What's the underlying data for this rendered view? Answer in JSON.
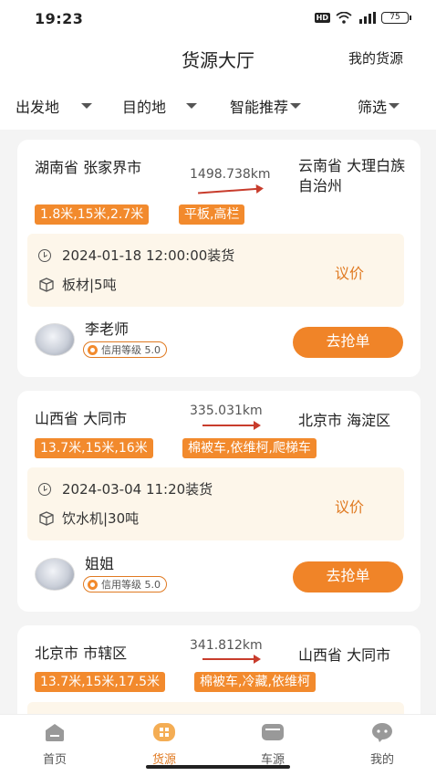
{
  "status_bar": {
    "time": "19:23",
    "hd": "HD",
    "signal": "4G",
    "battery": "75"
  },
  "header": {
    "title": "货源大厅",
    "right_link": "我的货源"
  },
  "filters": [
    {
      "label": "出发地"
    },
    {
      "label": "目的地"
    },
    {
      "label": "智能推荐"
    },
    {
      "label": "筛选"
    }
  ],
  "cards": [
    {
      "from": "湖南省 张家界市",
      "to": "云南省 大理白族自治州",
      "distance": "1498.738km",
      "length_tag": "1.8米,15米,2.7米",
      "truck_tag": "平板,高栏",
      "load_time": "2024-01-18 12:00:00装货",
      "cargo": "板材|5吨",
      "price": "议价",
      "user_name": "李老师",
      "credit": "信用等级 5.0",
      "action": "去抢单"
    },
    {
      "from": "山西省 大同市",
      "to": "北京市 海淀区",
      "distance": "335.031km",
      "length_tag": "13.7米,15米,16米",
      "truck_tag": "棉被车,依维柯,爬梯车",
      "load_time": "2024-03-04 11:20装货",
      "cargo": "饮水机|30吨",
      "price": "议价",
      "user_name": "姐姐",
      "credit": "信用等级 5.0",
      "action": "去抢单"
    },
    {
      "from": "北京市 市辖区",
      "to": "山西省 大同市",
      "distance": "341.812km",
      "length_tag": "13.7米,15米,17.5米",
      "truck_tag": "棉被车,冷藏,依维柯"
    }
  ],
  "tabbar": [
    {
      "label": "首页",
      "icon": "home-icon",
      "active": false
    },
    {
      "label": "货源",
      "icon": "cargo-icon",
      "active": true
    },
    {
      "label": "车源",
      "icon": "truck-icon",
      "active": false
    },
    {
      "label": "我的",
      "icon": "profile-icon",
      "active": false
    }
  ],
  "colors": {
    "accent": "#f08428",
    "route": "#c83c2c",
    "detail_bg": "#fdf6ea"
  }
}
